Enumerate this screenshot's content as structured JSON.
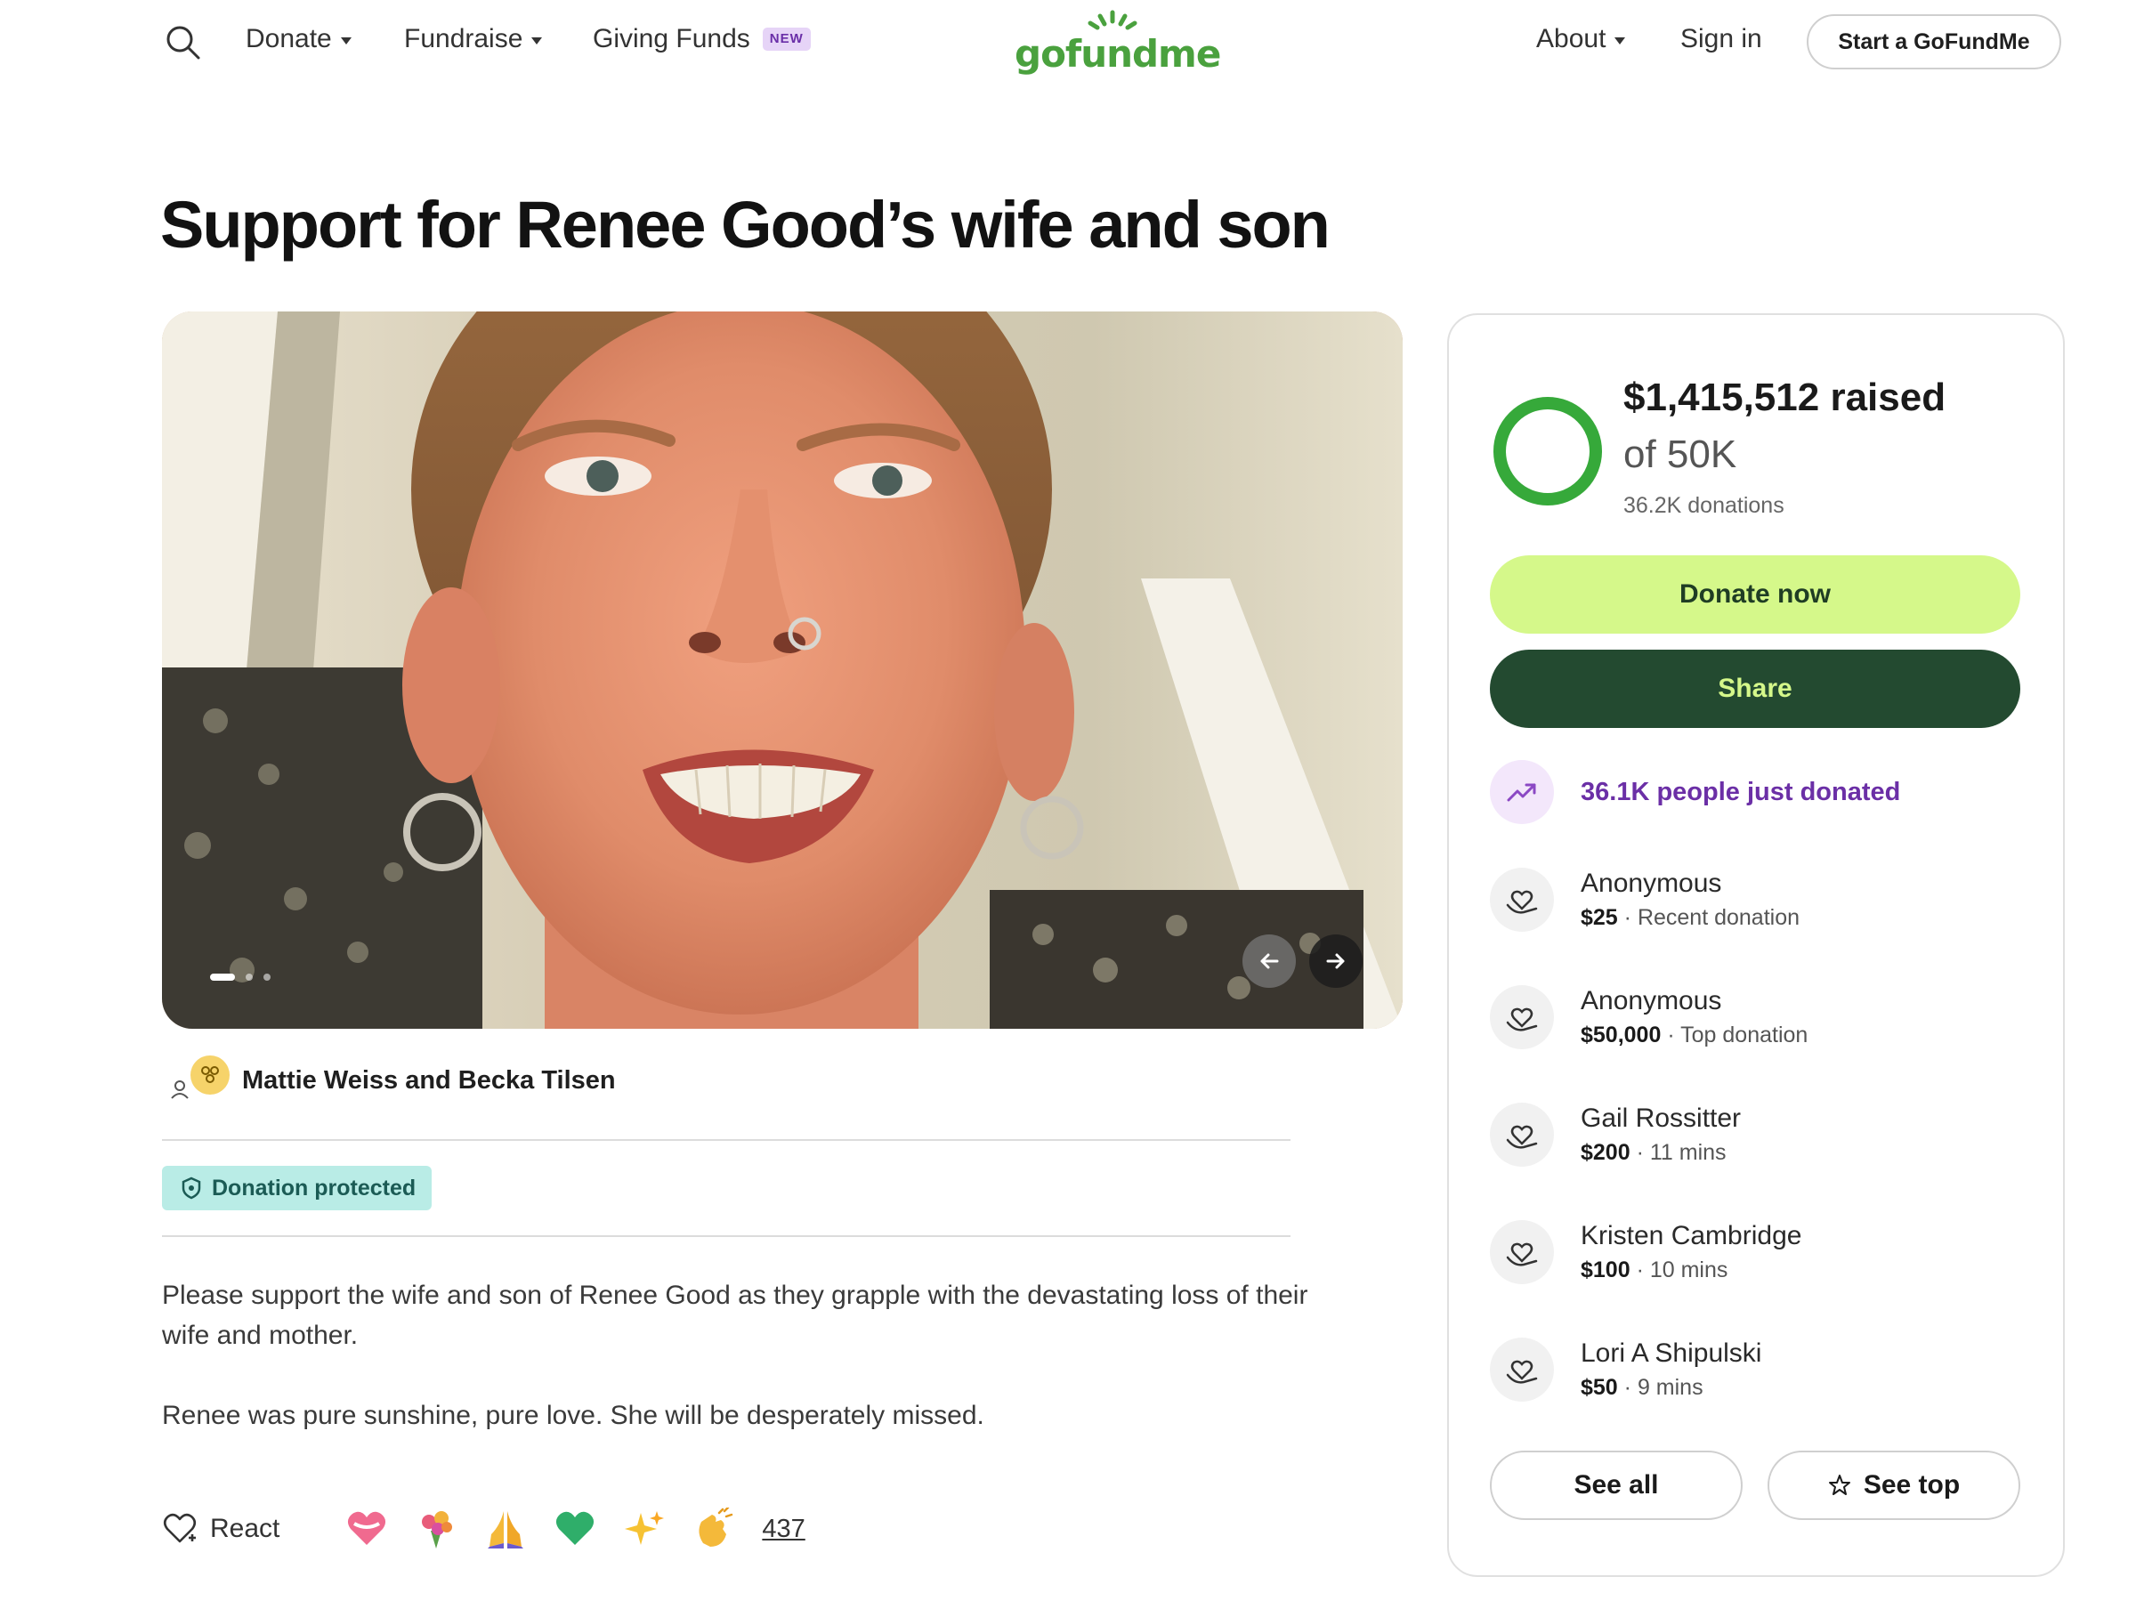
{
  "nav": {
    "items": [
      {
        "label": "Donate",
        "has_caret": true
      },
      {
        "label": "Fundraise",
        "has_caret": true
      },
      {
        "label": "Giving Funds",
        "badge": "NEW"
      }
    ],
    "logo_text": "gofundme",
    "about_label": "About",
    "signin_label": "Sign in",
    "start_label": "Start a GoFundMe"
  },
  "campaign": {
    "title": "Support for Renee Good’s wife and son",
    "organizer": "Mattie Weiss and Becka Tilsen",
    "protection_badge": "Donation protected",
    "description": [
      "Please support the wife and son of Renee Good as they grapple with the devastating loss of their wife and mother.",
      "Renee was pure sunshine, pure love. She will be desperately missed."
    ],
    "react_label": "React",
    "reaction_count": "437",
    "reactions": [
      "heart-emoji",
      "bouquet-emoji",
      "praying-hands-emoji",
      "green-heart-emoji",
      "sparkles-emoji",
      "clapping-hands-emoji"
    ]
  },
  "donation_card": {
    "raised": "$1,415,512 raised",
    "goal": "of 50K",
    "donations_count": "36.2K donations",
    "progress_fraction": 1.0,
    "donate_label": "Donate now",
    "share_label": "Share",
    "trend_text": "36.1K people just donated",
    "donors": [
      {
        "name": "Anonymous",
        "amount": "$25",
        "meta": "Recent donation"
      },
      {
        "name": "Anonymous",
        "amount": "$50,000",
        "meta": "Top donation"
      },
      {
        "name": "Gail Rossitter",
        "amount": "$200",
        "meta": "11 mins"
      },
      {
        "name": "Kristen Cambridge",
        "amount": "$100",
        "meta": "10 mins"
      },
      {
        "name": "Lori A Shipulski",
        "amount": "$50",
        "meta": "9 mins"
      }
    ],
    "see_all_label": "See all",
    "see_top_label": "See top"
  },
  "colors": {
    "brand_green": "#4aa13e",
    "donate_button": "#d5f88a",
    "share_button": "#234a30",
    "trend_purple": "#6b2fa6",
    "protect_badge": "#b9ece6"
  }
}
